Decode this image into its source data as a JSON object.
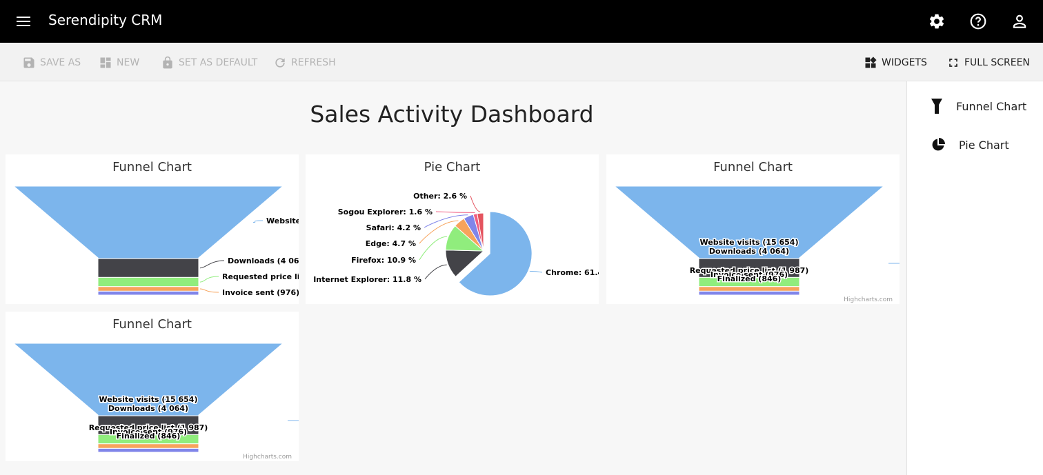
{
  "app": {
    "title": "Serendipity CRM"
  },
  "toolbar": {
    "save_as": "SAVE AS",
    "new": "NEW",
    "set_default": "SET AS DEFAULT",
    "refresh": "REFRESH",
    "widgets": "WIDGETS",
    "full_screen": "FULL SCREEN"
  },
  "sidebar": {
    "items": [
      {
        "label": "Funnel Chart",
        "icon": "funnel-icon"
      },
      {
        "label": "Pie Chart",
        "icon": "pie-chart-icon"
      }
    ]
  },
  "dashboard": {
    "title": "Sales Activity Dashboard"
  },
  "colors": {
    "blue": "#7cb5ec",
    "dark": "#434348",
    "green": "#90ed7d",
    "orange": "#f7a35c",
    "purple": "#8085e9",
    "pink": "#f15c80",
    "red": "#e4545f"
  },
  "chart_data": [
    {
      "type": "funnel",
      "title": "Funnel Chart",
      "series": [
        {
          "name": "",
          "categories": [
            "Website visits",
            "Downloads",
            "Requested price list",
            "Invoice sent",
            "Finalized"
          ],
          "values": [
            15654,
            4064,
            1987,
            976,
            846
          ]
        }
      ],
      "data_labels": [
        "Website",
        "Downloads (4 06",
        "Requested price lis",
        "Invoice sent (976)"
      ],
      "credits": ""
    },
    {
      "type": "pie",
      "title": "Pie Chart",
      "categories": [
        "Chrome",
        "Internet Explorer",
        "Firefox",
        "Edge",
        "Safari",
        "Sogou Explorer",
        "Other"
      ],
      "values": [
        61.41,
        11.84,
        10.85,
        4.67,
        4.18,
        1.64,
        2.61
      ],
      "data_labels": [
        "Chrome: 61.4",
        "Internet Explorer: 11.8 %",
        "Firefox: 10.9 %",
        "Edge: 4.7 %",
        "Safari: 4.2 %",
        "Sogou Explorer: 1.6 %",
        "Other: 2.6 %"
      ],
      "sliced": "Chrome"
    },
    {
      "type": "funnel",
      "title": "Funnel Chart",
      "series": [
        {
          "name": "",
          "categories": [
            "Website visits",
            "Downloads",
            "Requested price list",
            "Invoice sent",
            "Finalized"
          ],
          "values": [
            15654,
            4064,
            1987,
            976,
            846
          ]
        }
      ],
      "data_labels": [
        "Website visits (15 654)",
        "Downloads (4 064)",
        "Requested price list (1 987)",
        "Invoice sent (976)",
        "Finalized (846)"
      ],
      "credits": "Highcharts.com"
    },
    {
      "type": "funnel",
      "title": "Funnel Chart",
      "series": [
        {
          "name": "",
          "categories": [
            "Website visits",
            "Downloads",
            "Requested price list",
            "Invoice sent",
            "Finalized"
          ],
          "values": [
            15654,
            4064,
            1987,
            976,
            846
          ]
        }
      ],
      "data_labels": [
        "Website visits (15 654)",
        "Downloads (4 064)",
        "Requested price list (1 987)",
        "Invoice sent (976)",
        "Finalized (846)"
      ],
      "credits": "Highcharts.com"
    }
  ]
}
